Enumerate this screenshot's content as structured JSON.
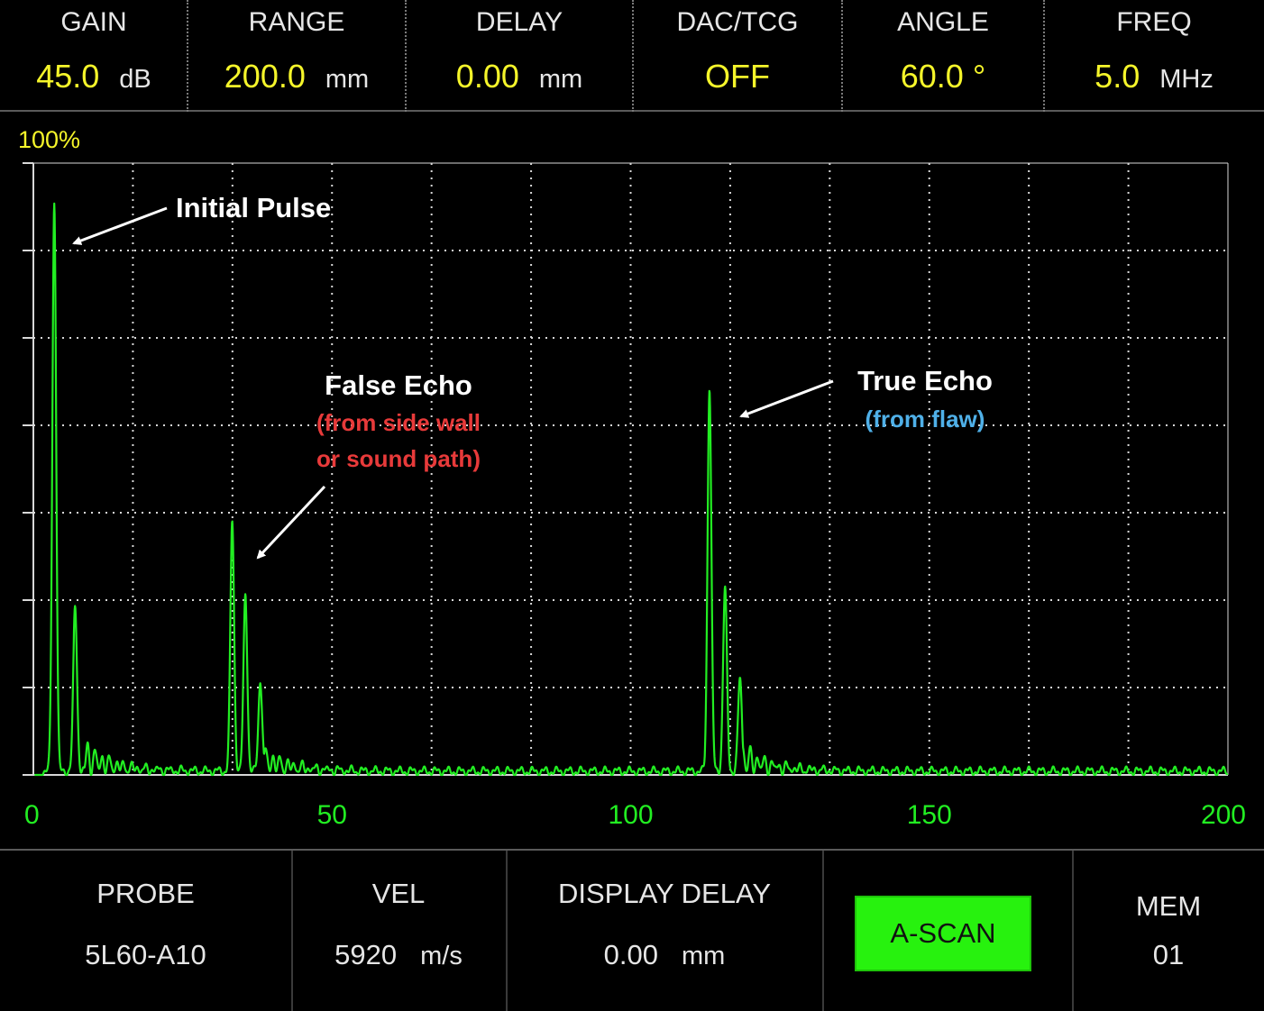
{
  "header": {
    "params": [
      {
        "label": "GAIN",
        "value": "45.0",
        "unit": "dB"
      },
      {
        "label": "RANGE",
        "value": "200.0",
        "unit": "mm"
      },
      {
        "label": "DELAY",
        "value": "0.00",
        "unit": "mm"
      },
      {
        "label": "DAC/TCG",
        "value": "OFF",
        "unit": ""
      },
      {
        "label": "ANGLE",
        "value": "60.0 °",
        "unit": ""
      },
      {
        "label": "FREQ",
        "value": "5.0",
        "unit": "MHz"
      }
    ]
  },
  "screen": {
    "amplitude_max_label": "100%",
    "trace_color": "#22ee22",
    "grid_color": "#d8d8d8",
    "annotations": {
      "initial_pulse": "Initial Pulse",
      "false_echo_title": "False Echo",
      "false_echo_line1": "(from side wall",
      "false_echo_line2": "or sound path)",
      "true_echo_title": "True Echo",
      "true_echo_sub": "(from flaw)",
      "false_echo_color": "#e83a3a",
      "true_echo_color": "#4fb0e8"
    }
  },
  "chart_data": {
    "type": "line",
    "xlim": [
      0,
      200
    ],
    "ylim": [
      0,
      100
    ],
    "x_ticks": [
      "0",
      "50",
      "100",
      "150",
      "200"
    ],
    "ylabel": "100%",
    "grid": true,
    "series": [
      {
        "peaks": [
          {
            "x": 3.5,
            "amplitude": 93
          },
          {
            "x": 7.0,
            "amplitude": 27
          },
          {
            "x": 33.3,
            "amplitude": 41
          },
          {
            "x": 35.5,
            "amplitude": 29
          },
          {
            "x": 38.0,
            "amplitude": 15
          },
          {
            "x": 113.2,
            "amplitude": 63
          },
          {
            "x": 115.8,
            "amplitude": 30
          },
          {
            "x": 118.3,
            "amplitude": 15
          }
        ],
        "noise_floor": 1
      }
    ]
  },
  "footer": {
    "probe": {
      "label": "PROBE",
      "value": "5L60-A10"
    },
    "vel": {
      "label": "VEL",
      "value": "5920",
      "unit": "m/s"
    },
    "display_delay": {
      "label": "DISPLAY DELAY",
      "value": "0.00",
      "unit": "mm"
    },
    "mode_button": "A-SCAN",
    "mem": {
      "label": "MEM",
      "value": "01"
    }
  }
}
